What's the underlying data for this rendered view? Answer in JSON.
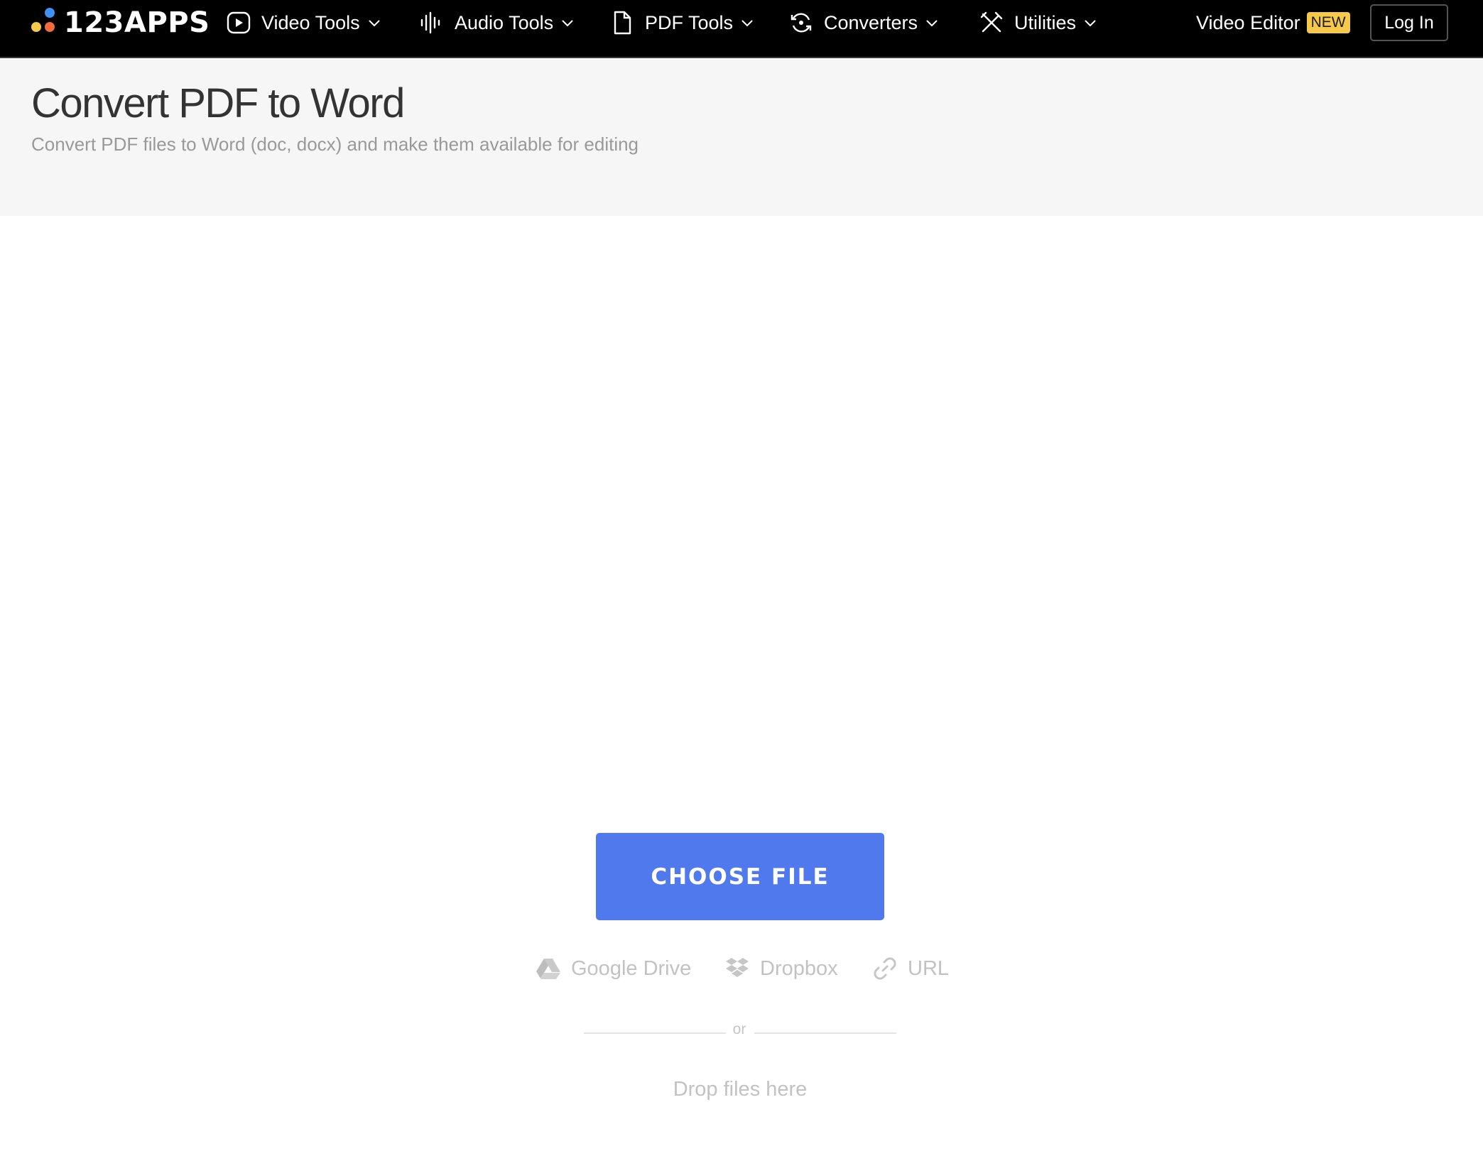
{
  "nav": {
    "logo_text": "123APPS",
    "items": [
      {
        "label": "Video Tools",
        "icon": "play-circle-icon"
      },
      {
        "label": "Audio Tools",
        "icon": "waveform-icon"
      },
      {
        "label": "PDF Tools",
        "icon": "document-icon"
      },
      {
        "label": "Converters",
        "icon": "convert-icon"
      },
      {
        "label": "Utilities",
        "icon": "tools-icon"
      }
    ],
    "video_editor_label": "Video Editor",
    "new_badge": "NEW",
    "login_label": "Log In"
  },
  "header": {
    "title": "Convert PDF to Word",
    "subtitle": "Convert PDF files to Word (doc, docx) and make them available for editing"
  },
  "upload": {
    "choose_file_label": "CHOOSE FILE",
    "sources": [
      {
        "label": "Google Drive",
        "icon": "google-drive-icon"
      },
      {
        "label": "Dropbox",
        "icon": "dropbox-icon"
      },
      {
        "label": "URL",
        "icon": "link-icon"
      }
    ],
    "or_label": "or",
    "drop_label": "Drop files here"
  },
  "colors": {
    "topbar_bg": "#000000",
    "accent_button": "#5079ee",
    "new_badge": "#f7c94a",
    "header_bg": "#f6f6f6"
  }
}
